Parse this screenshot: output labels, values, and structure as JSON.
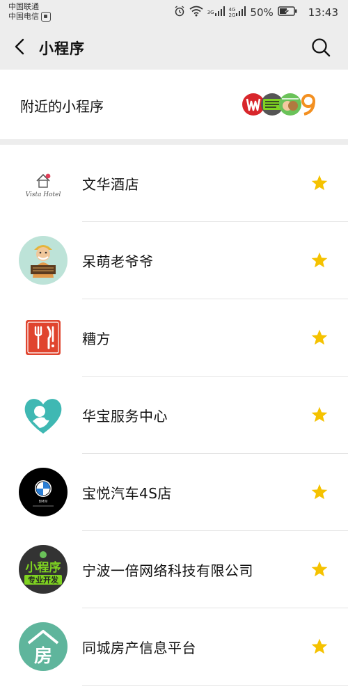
{
  "status_bar": {
    "carrier_1": "中国联通",
    "carrier_2": "中国电信",
    "net_1": "3G",
    "net_2_top": "4G",
    "net_2_bottom": "2G",
    "battery": "50%",
    "time": "13:43"
  },
  "nav": {
    "title": "小程序",
    "back_icon": "chevron-left-icon",
    "search_icon": "search-icon"
  },
  "nearby": {
    "label": "附近的小程序",
    "logos": [
      "red-w-logo",
      "mini-program-logo",
      "shop-logo",
      "orange-9-logo"
    ]
  },
  "apps": [
    {
      "name": "文华酒店",
      "icon": "vista-hotel-logo",
      "icon_text": "Vista Hotel",
      "starred": true
    },
    {
      "name": "呆萌老爷爷",
      "icon": "cartoon-grandpa-avatar",
      "starred": true
    },
    {
      "name": "糟方",
      "icon": "fork-knife-logo",
      "starred": true
    },
    {
      "name": "华宝服务中心",
      "icon": "mother-child-heart-logo",
      "starred": true
    },
    {
      "name": "宝悦汽车4S店",
      "icon": "bmw-logo",
      "icon_text": "BMW",
      "starred": true
    },
    {
      "name": "宁波一倍网络科技有限公司",
      "icon": "mini-program-dev-logo",
      "icon_text_1": "小程序",
      "icon_text_2": "专业开发",
      "starred": true
    },
    {
      "name": "同城房产信息平台",
      "icon": "house-fang-logo",
      "icon_text": "房",
      "starred": true
    }
  ],
  "colors": {
    "star": "#f5c200",
    "header_bg": "#ededed",
    "divider": "#e3e3e3"
  }
}
